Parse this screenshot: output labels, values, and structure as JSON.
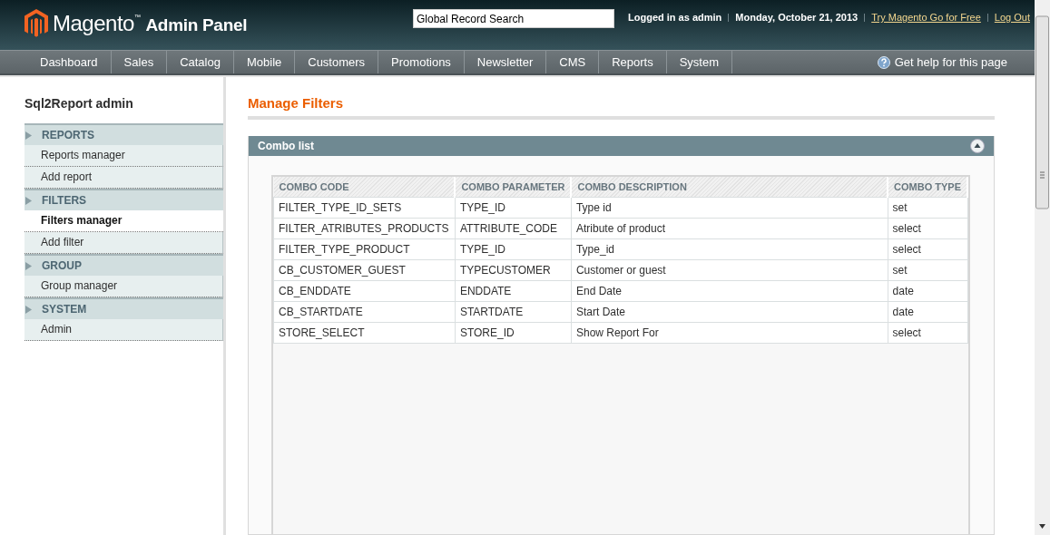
{
  "header": {
    "logo_text": "Magento",
    "logo_mark": "™",
    "title": "Admin Panel",
    "search": {
      "value": "Global Record Search"
    },
    "user": "Logged in as admin",
    "date": "Monday, October 21, 2013",
    "links": [
      "Try Magento Go for Free",
      "Log Out"
    ]
  },
  "nav": {
    "items": [
      "Dashboard",
      "Sales",
      "Catalog",
      "Mobile",
      "Customers",
      "Promotions",
      "Newsletter",
      "CMS",
      "Reports",
      "System"
    ],
    "help": "Get help for this page"
  },
  "sidebar": {
    "title": "Sql2Report admin",
    "sections": [
      {
        "title": "REPORTS",
        "items": [
          {
            "label": "Reports manager",
            "selected": false
          },
          {
            "label": "Add report",
            "selected": false
          }
        ]
      },
      {
        "title": "FILTERS",
        "items": [
          {
            "label": "Filters manager",
            "selected": true
          },
          {
            "label": "Add filter",
            "selected": false
          }
        ]
      },
      {
        "title": "GROUP",
        "items": [
          {
            "label": "Group manager",
            "selected": false
          }
        ]
      },
      {
        "title": "SYSTEM",
        "items": [
          {
            "label": "Admin",
            "selected": false
          }
        ]
      }
    ]
  },
  "page_title": "Manage Filters",
  "panel": {
    "title": "Combo list",
    "expanded": true,
    "table": {
      "columns": [
        "COMBO CODE",
        "COMBO PARAMETER",
        "COMBO DESCRIPTION",
        "COMBO TYPE"
      ],
      "rows": [
        [
          "FILTER_TYPE_ID_SETS",
          "TYPE_ID",
          "Type id",
          "set"
        ],
        [
          "FILTER_ATRIBUTES_PRODUCTS",
          "ATTRIBUTE_CODE",
          "Atribute of product",
          "select"
        ],
        [
          "FILTER_TYPE_PRODUCT",
          "TYPE_ID",
          "Type_id",
          "select"
        ],
        [
          "CB_CUSTOMER_GUEST",
          "TYPECUSTOMER",
          "Customer or guest",
          "set"
        ],
        [
          "CB_ENDDATE",
          "ENDDATE",
          "End Date",
          "date"
        ],
        [
          "CB_STARTDATE",
          "STARTDATE",
          "Start Date",
          "date"
        ],
        [
          "STORE_SELECT",
          "STORE_ID",
          "Show Report For",
          "select"
        ]
      ]
    }
  }
}
